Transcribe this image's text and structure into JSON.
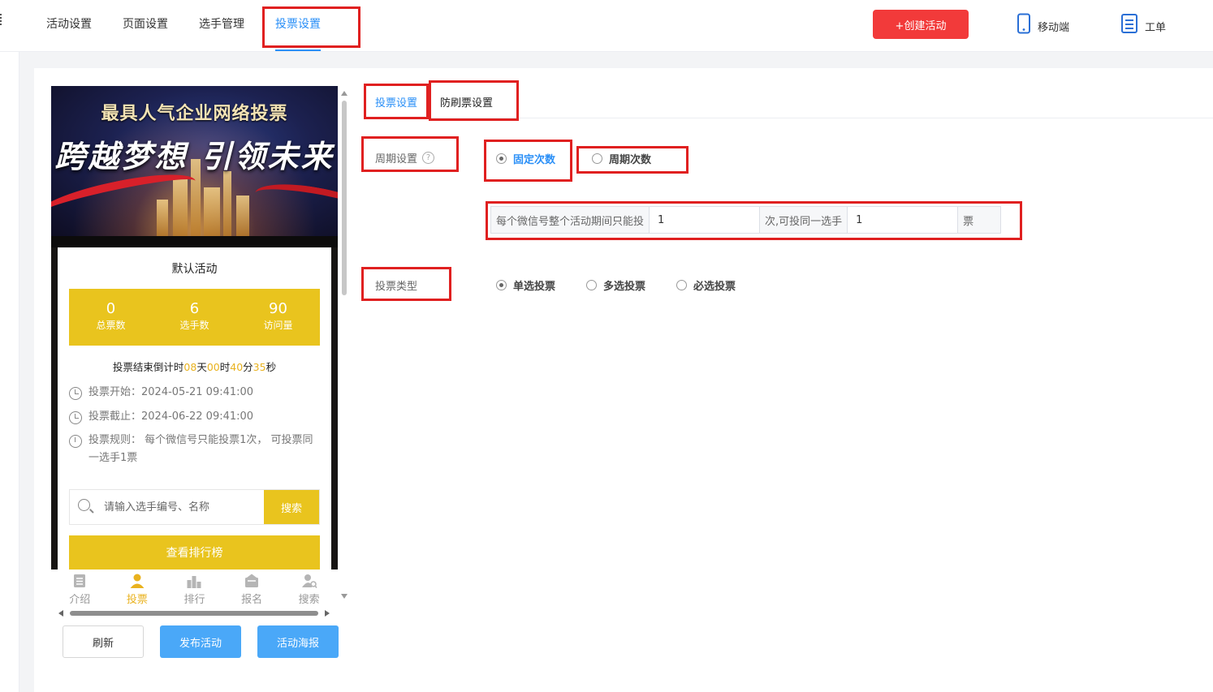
{
  "nav": {
    "items": [
      "活动设置",
      "页面设置",
      "选手管理",
      "投票设置"
    ],
    "create_label": "+创建活动",
    "mobile_label": "移动端",
    "ticket_label": "工单"
  },
  "preview": {
    "banner_title": "最具人气企业网络投票",
    "banner_slogan": "跨越梦想 引领未来",
    "activity_title": "默认活动",
    "stats": [
      {
        "value": "0",
        "label": "总票数"
      },
      {
        "value": "6",
        "label": "选手数"
      },
      {
        "value": "90",
        "label": "访问量"
      }
    ],
    "countdown": {
      "prefix": "投票结束倒计时",
      "days": "08",
      "days_unit": "天",
      "hours": "00",
      "hours_unit": "时",
      "minutes": "40",
      "minutes_unit": "分",
      "seconds": "35",
      "seconds_unit": "秒"
    },
    "vote_start": "投票开始：2024-05-21 09:41:00",
    "vote_end": "投票截止：2024-06-22 09:41:00",
    "vote_rule": "投票规则： 每个微信号只能投票1次， 可投票同一选手1票",
    "search_placeholder": "请输入选手编号、名称",
    "search_button": "搜索",
    "rank_button": "查看排行榜",
    "tabs": [
      "介绍",
      "投票",
      "排行",
      "报名",
      "搜索"
    ]
  },
  "actions": {
    "refresh": "刷新",
    "publish": "发布活动",
    "poster": "活动海报"
  },
  "form": {
    "tabs": [
      "投票设置",
      "防刷票设置"
    ],
    "cycle_label": "周期设置",
    "cycle_help": "?",
    "cycle_options": [
      "固定次数",
      "周期次数"
    ],
    "limit_prefix": "每个微信号整个活动期间只能投",
    "limit_times": "1",
    "limit_middle": "次,可投同一选手",
    "limit_votes": "1",
    "limit_suffix": "票",
    "type_label": "投票类型",
    "type_options": [
      "单选投票",
      "多选投票",
      "必选投票"
    ]
  },
  "colors": {
    "accent_blue": "#2a8ff7",
    "brand_yellow": "#e9c41e",
    "create_red": "#f23a3a",
    "highlight_red": "#e02020"
  }
}
